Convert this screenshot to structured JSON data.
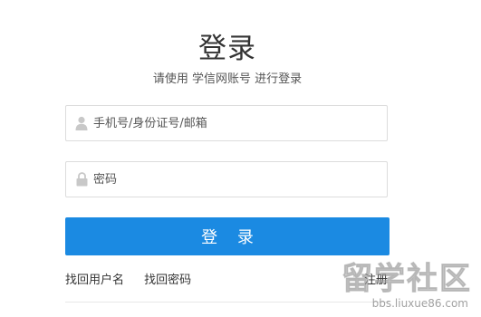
{
  "header": {
    "title": "登录",
    "subtitle": "请使用 学信网账号 进行登录"
  },
  "form": {
    "username": {
      "placeholder": "手机号/身份证号/邮箱",
      "value": "",
      "icon": "user-icon"
    },
    "password": {
      "placeholder": "密码",
      "value": "",
      "icon": "lock-icon"
    },
    "submit_label": "登 录"
  },
  "links": {
    "forgot_username": "找回用户名",
    "forgot_password": "找回密码",
    "register": "注册"
  },
  "watermark": {
    "main": "留学社区",
    "url": "bbs.liuxue86.com"
  },
  "colors": {
    "primary": "#1b8ae2",
    "text": "#333333",
    "border": "#dcdcdc",
    "icon": "#c8c8c8"
  }
}
